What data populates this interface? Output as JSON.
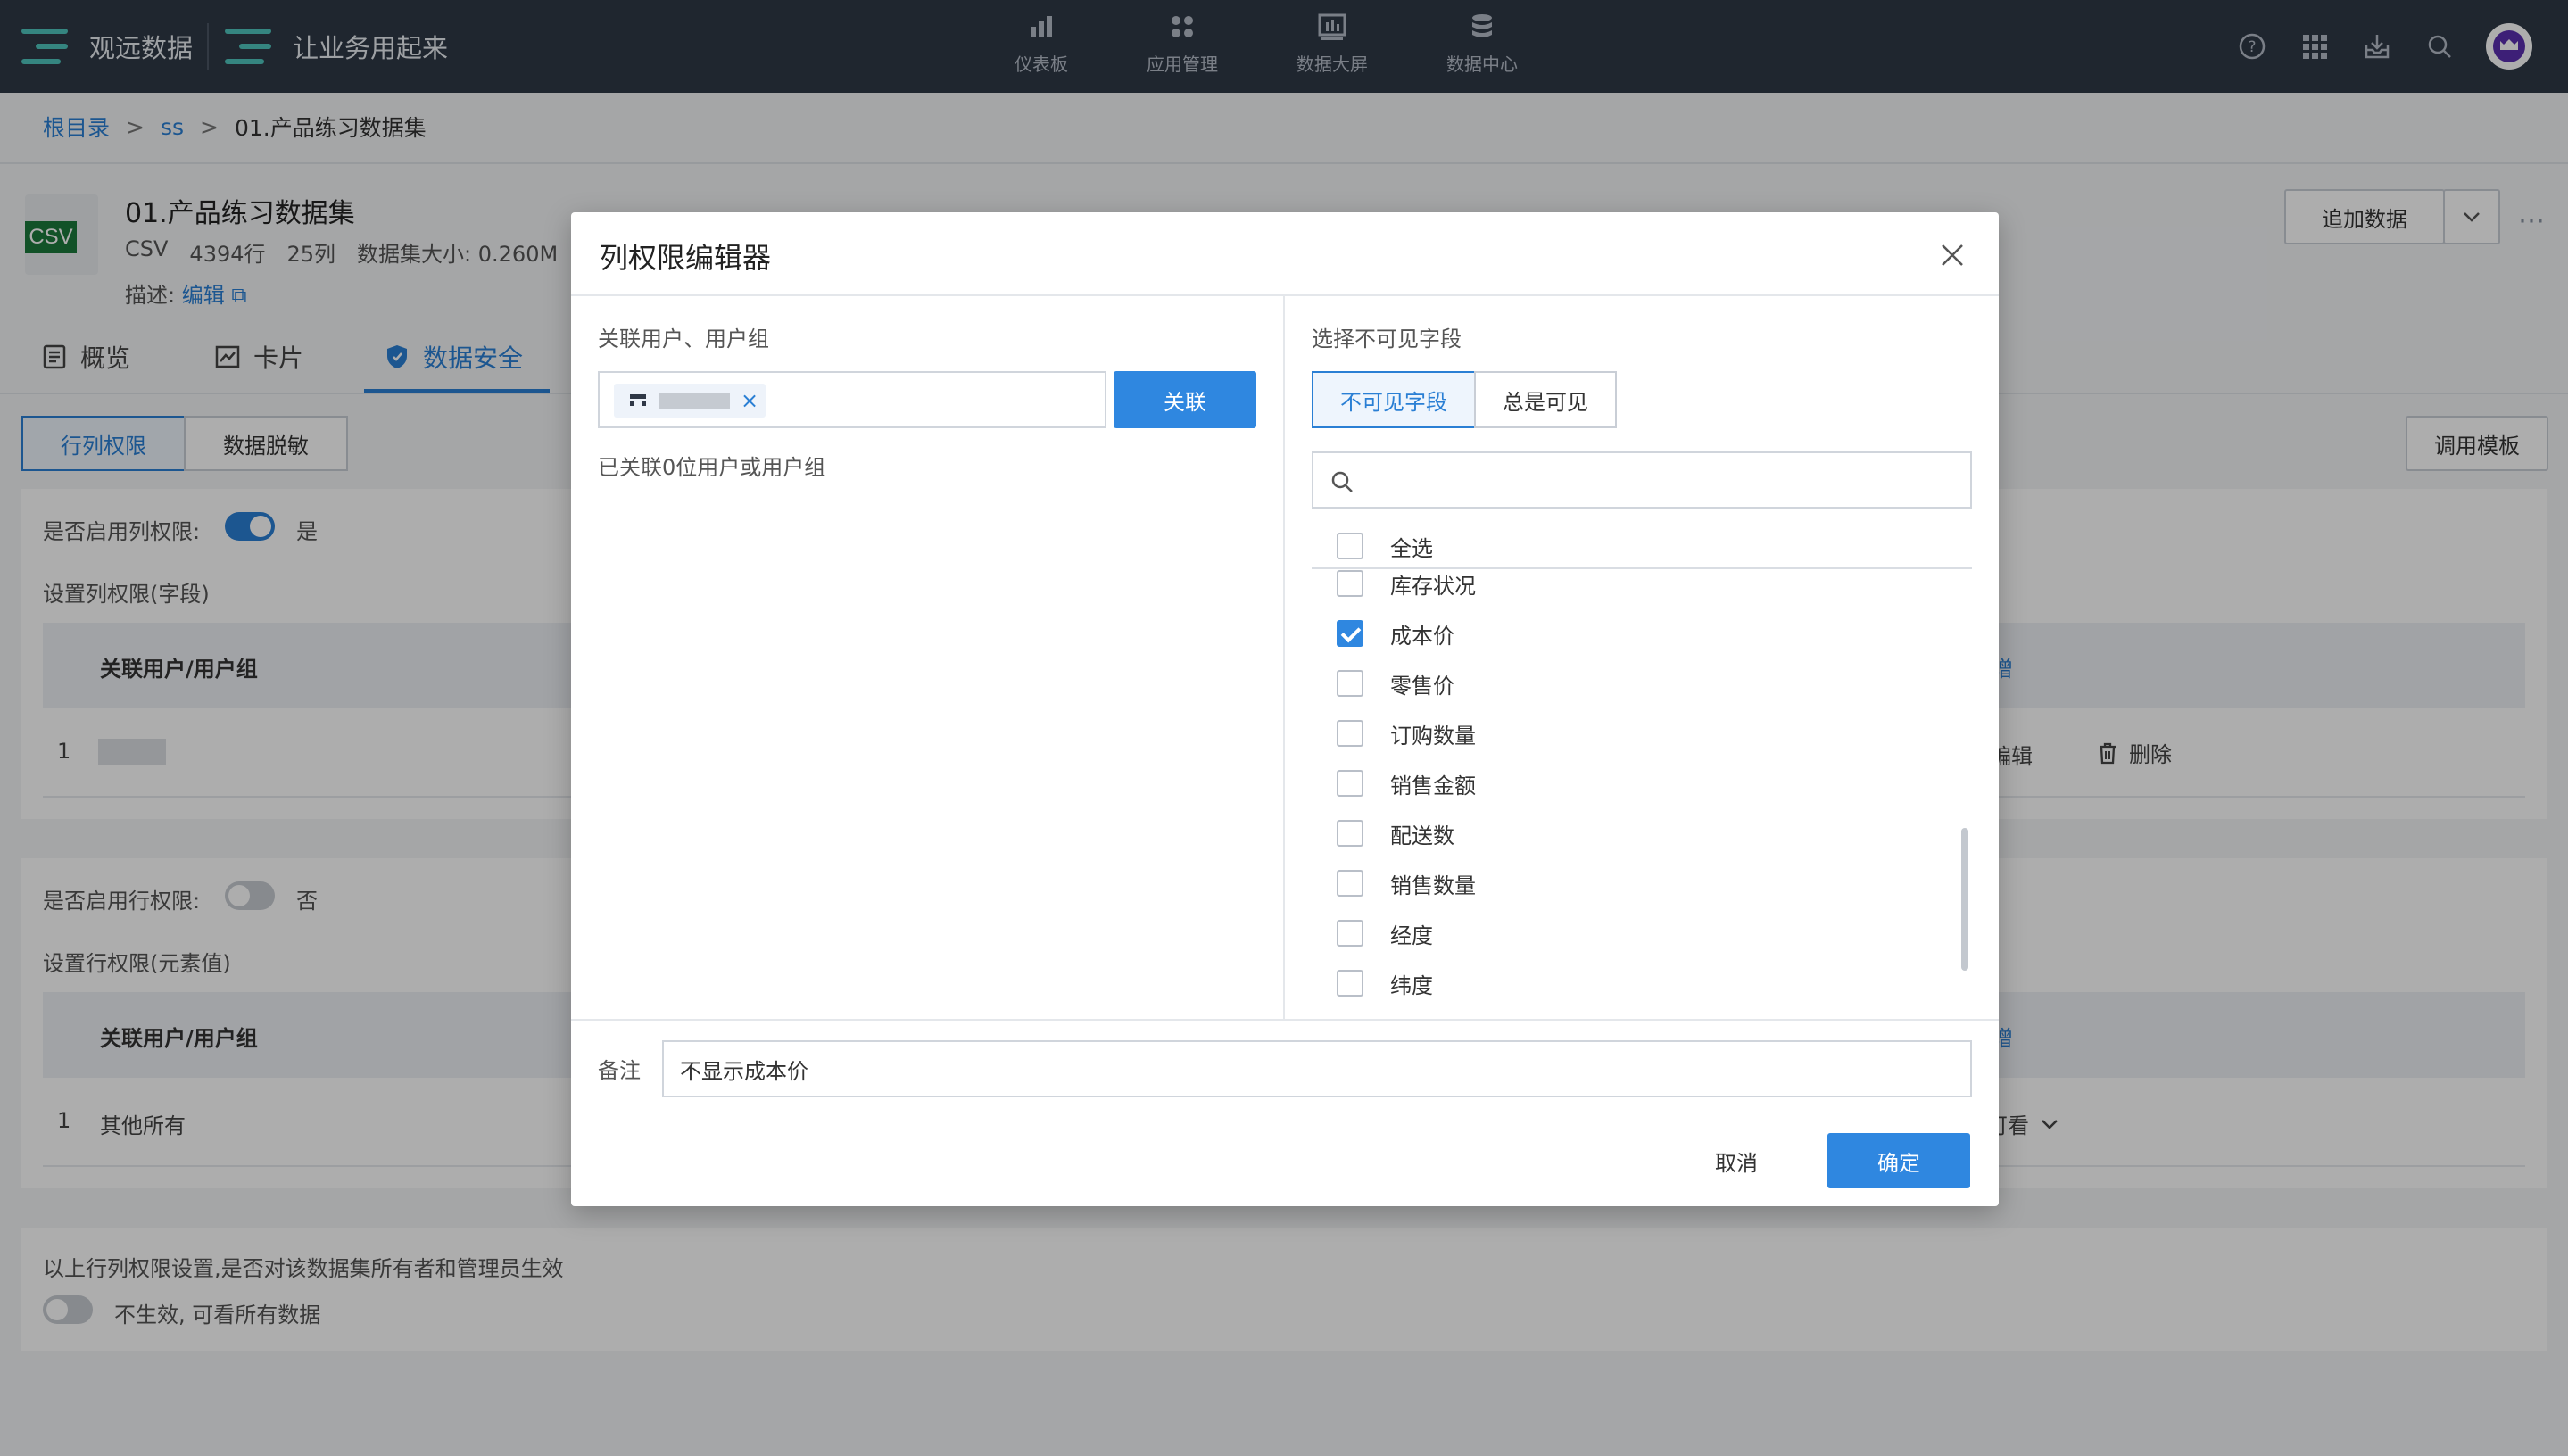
{
  "topbar": {
    "brand1": "观远数据",
    "brand2": "让业务用起来",
    "nav": [
      {
        "label": "仪表板",
        "icon": "bar-chart-icon"
      },
      {
        "label": "应用管理",
        "icon": "apps-icon"
      },
      {
        "label": "数据大屏",
        "icon": "dashboard-screen-icon"
      },
      {
        "label": "数据中心",
        "icon": "database-icon"
      }
    ]
  },
  "breadcrumb": {
    "root": "根目录",
    "sep": ">",
    "folder": "ss",
    "current": "01.产品练习数据集"
  },
  "dataset": {
    "file_type": "CSV",
    "title": "01.产品练习数据集",
    "type": "CSV",
    "rows": "4394行",
    "cols": "25列",
    "size": "数据集大小: 0.260M",
    "desc_label": "描述:",
    "edit_link": "编辑",
    "append_button": "追加数据"
  },
  "tabs": {
    "overview": "概览",
    "card": "卡片",
    "security": "数据安全"
  },
  "subtabs": {
    "row_col": "行列权限",
    "masking": "数据脱敏",
    "template": "调用模板"
  },
  "column_section": {
    "enable_label": "是否启用列权限:",
    "enable_value": "是",
    "setting_label": "设置列权限(字段)",
    "header_user": "关联用户/用户组",
    "header_action": "增",
    "row_index": "1",
    "edit": "编辑",
    "delete": "删除"
  },
  "row_section": {
    "enable_label": "是否启用行权限:",
    "enable_value": "否",
    "setting_label": "设置行权限(元素值)",
    "header_user": "关联用户/用户组",
    "header_action": "增",
    "row_index": "1",
    "row_value": "其他所有",
    "row_perm": "可看"
  },
  "owner_section": {
    "label": "以上行列权限设置,是否对该数据集所有者和管理员生效",
    "value": "不生效, 可看所有数据"
  },
  "modal": {
    "title": "列权限编辑器",
    "left_label": "关联用户、用户组",
    "associate_button": "关联",
    "associated_count": "已关联0位用户或用户组",
    "right_label": "选择不可见字段",
    "seg_invisible": "不可见字段",
    "seg_visible": "总是可见",
    "search_placeholder": "",
    "select_all": "全选",
    "fields": [
      {
        "name": "库存状况",
        "checked": false
      },
      {
        "name": "成本价",
        "checked": true
      },
      {
        "name": "零售价",
        "checked": false
      },
      {
        "name": "订购数量",
        "checked": false
      },
      {
        "name": "销售金额",
        "checked": false
      },
      {
        "name": "配送数",
        "checked": false
      },
      {
        "name": "销售数量",
        "checked": false
      },
      {
        "name": "经度",
        "checked": false
      },
      {
        "name": "纬度",
        "checked": false
      }
    ],
    "remark_label": "备注",
    "remark_value": "不显示成本价",
    "cancel_button": "取消",
    "confirm_button": "确定"
  },
  "colors": {
    "primary": "#2f87e0",
    "topbar": "#2f3846",
    "brand_accent": "#4fc4bd"
  }
}
